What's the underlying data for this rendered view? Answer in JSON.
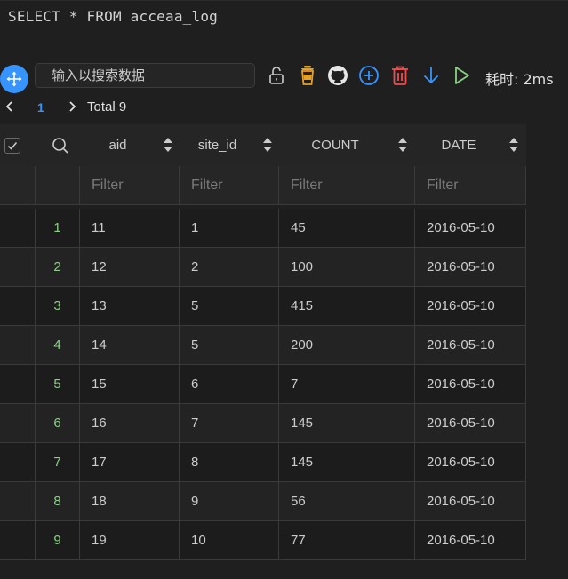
{
  "editor": {
    "sql": "SELECT * FROM acceaa_log"
  },
  "toolbar": {
    "search_placeholder": "输入以搜索数据",
    "elapsed": "耗时: 2ms",
    "icons": [
      "move-icon",
      "unlock-icon",
      "coffee-icon",
      "github-icon",
      "plus-circle-icon",
      "trash-icon",
      "download-arrow-icon",
      "run-play-icon"
    ],
    "colors": {
      "accent": "#3794ff",
      "coffee": "#e5a028",
      "trash": "#f14c4c",
      "run": "#89d185"
    }
  },
  "pager": {
    "page": "1",
    "total": "Total 9"
  },
  "table": {
    "columns": [
      "aid",
      "site_id",
      "COUNT",
      "DATE"
    ],
    "filter_placeholder": "Filter",
    "rows": [
      {
        "n": "1",
        "aid": "11",
        "site_id": "1",
        "count": "45",
        "date": "2016-05-10"
      },
      {
        "n": "2",
        "aid": "12",
        "site_id": "2",
        "count": "100",
        "date": "2016-05-10"
      },
      {
        "n": "3",
        "aid": "13",
        "site_id": "5",
        "count": "415",
        "date": "2016-05-10"
      },
      {
        "n": "4",
        "aid": "14",
        "site_id": "5",
        "count": "200",
        "date": "2016-05-10"
      },
      {
        "n": "5",
        "aid": "15",
        "site_id": "6",
        "count": "7",
        "date": "2016-05-10"
      },
      {
        "n": "6",
        "aid": "16",
        "site_id": "7",
        "count": "145",
        "date": "2016-05-10"
      },
      {
        "n": "7",
        "aid": "17",
        "site_id": "8",
        "count": "145",
        "date": "2016-05-10"
      },
      {
        "n": "8",
        "aid": "18",
        "site_id": "9",
        "count": "56",
        "date": "2016-05-10"
      },
      {
        "n": "9",
        "aid": "19",
        "site_id": "10",
        "count": "77",
        "date": "2016-05-10"
      }
    ]
  }
}
